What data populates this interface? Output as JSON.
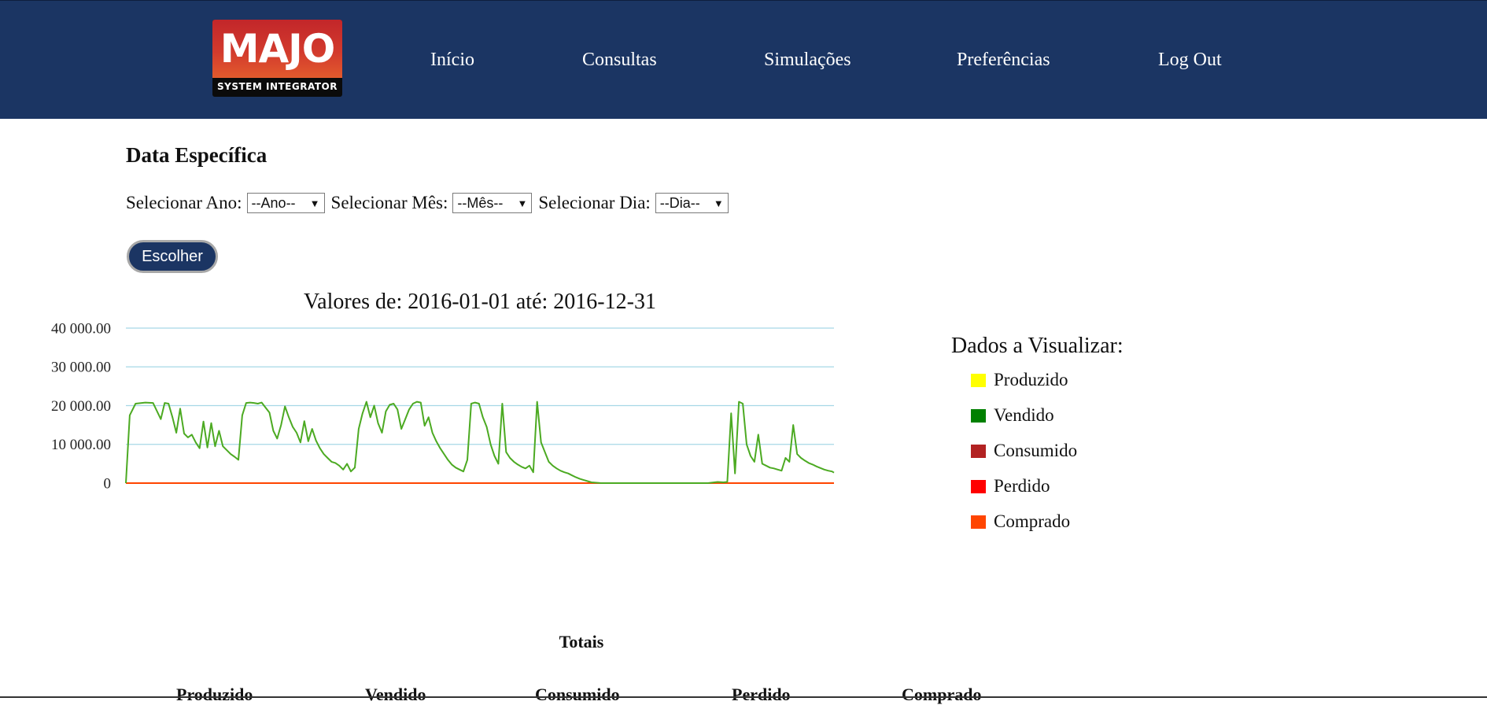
{
  "header": {
    "logo_main": "MAJO",
    "logo_sub": "SYSTEM INTEGRATOR",
    "nav": [
      "Início",
      "Consultas",
      "Simulações",
      "Preferências",
      "Log Out"
    ]
  },
  "section_title": "Data Específica",
  "filters": {
    "year_label": "Selecionar Ano:",
    "year_value": "--Ano--",
    "month_label": "Selecionar Mês:",
    "month_value": "--Mês--",
    "day_label": "Selecionar Dia:",
    "day_value": "--Dia--",
    "submit_label": "Escolher"
  },
  "chart_data": {
    "type": "line",
    "title": "Valores de: 2016-01-01 até: 2016-12-31",
    "xlabel": "",
    "ylabel": "",
    "x_range": [
      "2016-01-01",
      "2016-12-31"
    ],
    "ylim": [
      0,
      40000
    ],
    "yticks": [
      0,
      10000,
      20000,
      30000,
      40000
    ],
    "ytick_labels": [
      "0",
      "10 000.00",
      "20 000.00",
      "30 000.00",
      "40 000.00"
    ],
    "grid": true,
    "series": [
      {
        "name": "Produzido",
        "color": "#ffff00",
        "values": []
      },
      {
        "name": "Vendido",
        "color": "#008000",
        "line_color": "#4caa22",
        "day_index": [
          0,
          2,
          5,
          10,
          14,
          18,
          20,
          22,
          24,
          26,
          28,
          30,
          32,
          34,
          36,
          38,
          40,
          42,
          44,
          46,
          48,
          50,
          52,
          54,
          56,
          58,
          60,
          62,
          64,
          66,
          68,
          70,
          72,
          74,
          76,
          78,
          80,
          82,
          84,
          86,
          88,
          90,
          92,
          94,
          96,
          98,
          100,
          102,
          104,
          106,
          108,
          110,
          112,
          114,
          116,
          118,
          120,
          122,
          124,
          126,
          128,
          130,
          132,
          134,
          136,
          138,
          140,
          142,
          144,
          146,
          148,
          150,
          152,
          154,
          156,
          158,
          160,
          162,
          164,
          166,
          168,
          170,
          172,
          174,
          176,
          178,
          180,
          182,
          184,
          186,
          188,
          190,
          192,
          194,
          196,
          198,
          200,
          202,
          204,
          206,
          208,
          210,
          212,
          214,
          216,
          218,
          220,
          222,
          224,
          226,
          228,
          230,
          232,
          234,
          236,
          238,
          240,
          245,
          250,
          255,
          260,
          265,
          270,
          275,
          280,
          285,
          290,
          295,
          300,
          305,
          308,
          310,
          312,
          314,
          316,
          318,
          320,
          322,
          324,
          326,
          328,
          330,
          332,
          334,
          336,
          338,
          340,
          342,
          344,
          346,
          348,
          350,
          352,
          354,
          356,
          358,
          360,
          362,
          364,
          365
        ],
        "values": [
          0,
          17500,
          20500,
          20800,
          20700,
          16500,
          20700,
          20500,
          17000,
          13000,
          19200,
          12800,
          11800,
          12500,
          10500,
          9000,
          15900,
          9200,
          15500,
          9500,
          13500,
          9500,
          8500,
          7500,
          6800,
          6000,
          17500,
          20700,
          20800,
          20700,
          20500,
          20800,
          19500,
          18200,
          13500,
          11500,
          15000,
          19800,
          17000,
          14500,
          13000,
          10500,
          16000,
          10800,
          14000,
          11000,
          9000,
          7500,
          6500,
          5500,
          5200,
          4500,
          3500,
          5000,
          3000,
          4000,
          14000,
          18000,
          21000,
          17000,
          20000,
          15500,
          13000,
          18500,
          20200,
          20500,
          19000,
          14000,
          16500,
          19000,
          20500,
          21000,
          20800,
          14800,
          17000,
          13000,
          10800,
          9000,
          7500,
          6000,
          4800,
          4000,
          3500,
          3000,
          6000,
          20500,
          20800,
          20500,
          17000,
          14500,
          10000,
          7000,
          5000,
          20500,
          8000,
          6500,
          5500,
          4800,
          4200,
          3800,
          4500,
          2800,
          21000,
          10500,
          8000,
          5500,
          4500,
          3800,
          3200,
          2800,
          2500,
          2000,
          1500,
          1100,
          800,
          500,
          200,
          0,
          0,
          0,
          0,
          0,
          0,
          0,
          0,
          0,
          0,
          0,
          0,
          300,
          200,
          300,
          18000,
          2500,
          21000,
          20500,
          10000,
          7000,
          5500,
          12500,
          5000,
          4500,
          4000,
          3800,
          3500,
          3200,
          6500,
          5500,
          15000,
          7500,
          6500,
          5800,
          5200,
          4800,
          4300,
          3900,
          3500,
          3200,
          3000,
          2700
        ]
      },
      {
        "name": "Consumido",
        "color": "#b22222",
        "values": []
      },
      {
        "name": "Perdido",
        "color": "#ff0000",
        "values": []
      },
      {
        "name": "Comprado",
        "color": "#ff4500",
        "values": []
      }
    ]
  },
  "legend": {
    "title": "Dados a Visualizar:",
    "items": [
      {
        "label": "Produzido",
        "color": "#ffff00"
      },
      {
        "label": "Vendido",
        "color": "#008000"
      },
      {
        "label": "Consumido",
        "color": "#b22222"
      },
      {
        "label": "Perdido",
        "color": "#ff0000"
      },
      {
        "label": "Comprado",
        "color": "#ff4500"
      }
    ]
  },
  "totals": {
    "title": "Totais",
    "columns": [
      "Produzido",
      "Vendido",
      "Consumido",
      "Perdido",
      "Comprado"
    ]
  }
}
